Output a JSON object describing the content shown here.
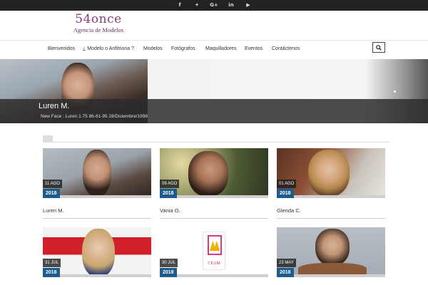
{
  "social": {
    "facebook": "f",
    "twitter": "✦",
    "gplus": "G+",
    "linkedin": "in",
    "youtube": "▶"
  },
  "logo": {
    "line1": "54once",
    "line2": "Agencia de Modelos"
  },
  "nav": [
    "Bienvenidos",
    "¿ Modelo o Anfitriona ?",
    "Modelos",
    "Fotógrafos",
    "Maquilladores",
    "Eventos",
    "Contáctenos"
  ],
  "hero": {
    "title": "Luren M.",
    "subtitle": "New Face : Luren 1.75 86-61-95 28/Diciembre/1998"
  },
  "cards": [
    {
      "day": "11 AGO",
      "year": "2018",
      "name": "Luren M."
    },
    {
      "day": "09 AGO",
      "year": "2018",
      "name": "Vania O."
    },
    {
      "day": "01 AGO",
      "year": "2018",
      "name": "Glenda C."
    },
    {
      "day": "31 JUL",
      "year": "2018",
      "name": ""
    },
    {
      "day": "30 JUL",
      "year": "2018",
      "name": ""
    },
    {
      "day": "23 MAY",
      "year": "2018",
      "name": ""
    }
  ],
  "ceam": {
    "text": "CEAM"
  },
  "colors": {
    "brand": "#8a3a7a",
    "year_badge": "#1e5a8c",
    "topbar": "#222222"
  }
}
